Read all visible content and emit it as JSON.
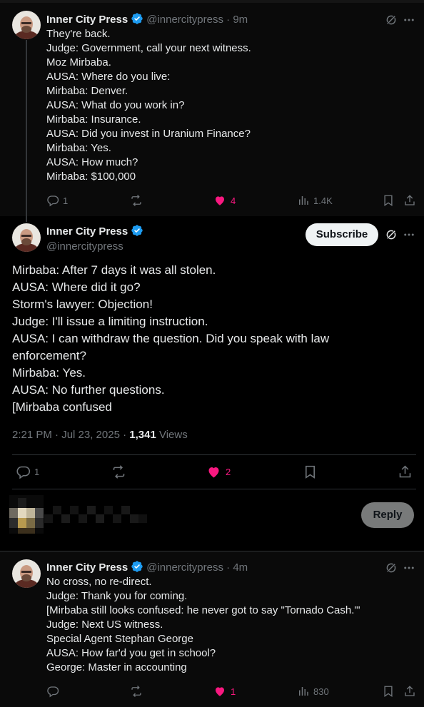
{
  "tweet1": {
    "author_name": "Inner City Press",
    "handle": "@innercitypress",
    "time": "9m",
    "lines": [
      "They're back.",
      "Judge: Government, call your next witness.",
      "Moz Mirbaba.",
      "AUSA: Where do you live:",
      "Mirbaba: Denver.",
      "AUSA: What do you work in?",
      "Mirbaba: Insurance.",
      "AUSA: Did you invest in Uranium Finance?",
      "Mirbaba: Yes.",
      "AUSA: How much?",
      "Mirbaba: $100,000"
    ],
    "replies": "1",
    "likes": "4",
    "views": "1.4K"
  },
  "tweet2": {
    "author_name": "Inner City Press",
    "handle": "@innercitypress",
    "subscribe_label": "Subscribe",
    "lines": [
      "Mirbaba: After 7 days it was all stolen.",
      "AUSA: Where did it go?",
      "Storm's lawyer: Objection!",
      "Judge: I'll issue a limiting instruction.",
      "AUSA: I can withdraw the question. Did you speak with law",
      "enforcement?",
      "Mirbaba: Yes.",
      "AUSA: No further questions.",
      "[Mirbaba confused"
    ],
    "timestamp": "2:21 PM · Jul 23, 2025 · ",
    "views_count": "1,341",
    "views_label": " Views",
    "replies": "1",
    "likes": "2"
  },
  "composer": {
    "reply_label": "Reply"
  },
  "tweet3": {
    "author_name": "Inner City Press",
    "handle": "@innercitypress",
    "time": "4m",
    "lines": [
      "No cross, no re-direct.",
      "Judge: Thank you for coming.",
      "[Mirbaba still looks confused: he never got to say \"Tornado Cash.\"'",
      "Judge: Next US witness.",
      "Special Agent Stephan George",
      "AUSA: How far'd you get in school?",
      "George: Master in accounting"
    ],
    "likes": "1",
    "views": "830"
  },
  "colors": {
    "background": "#000000",
    "tweet_bg": "#0a0a0a",
    "text": "#e7e9ea",
    "muted": "#71767b",
    "verified": "#1d9bf0",
    "like": "#f91880"
  }
}
